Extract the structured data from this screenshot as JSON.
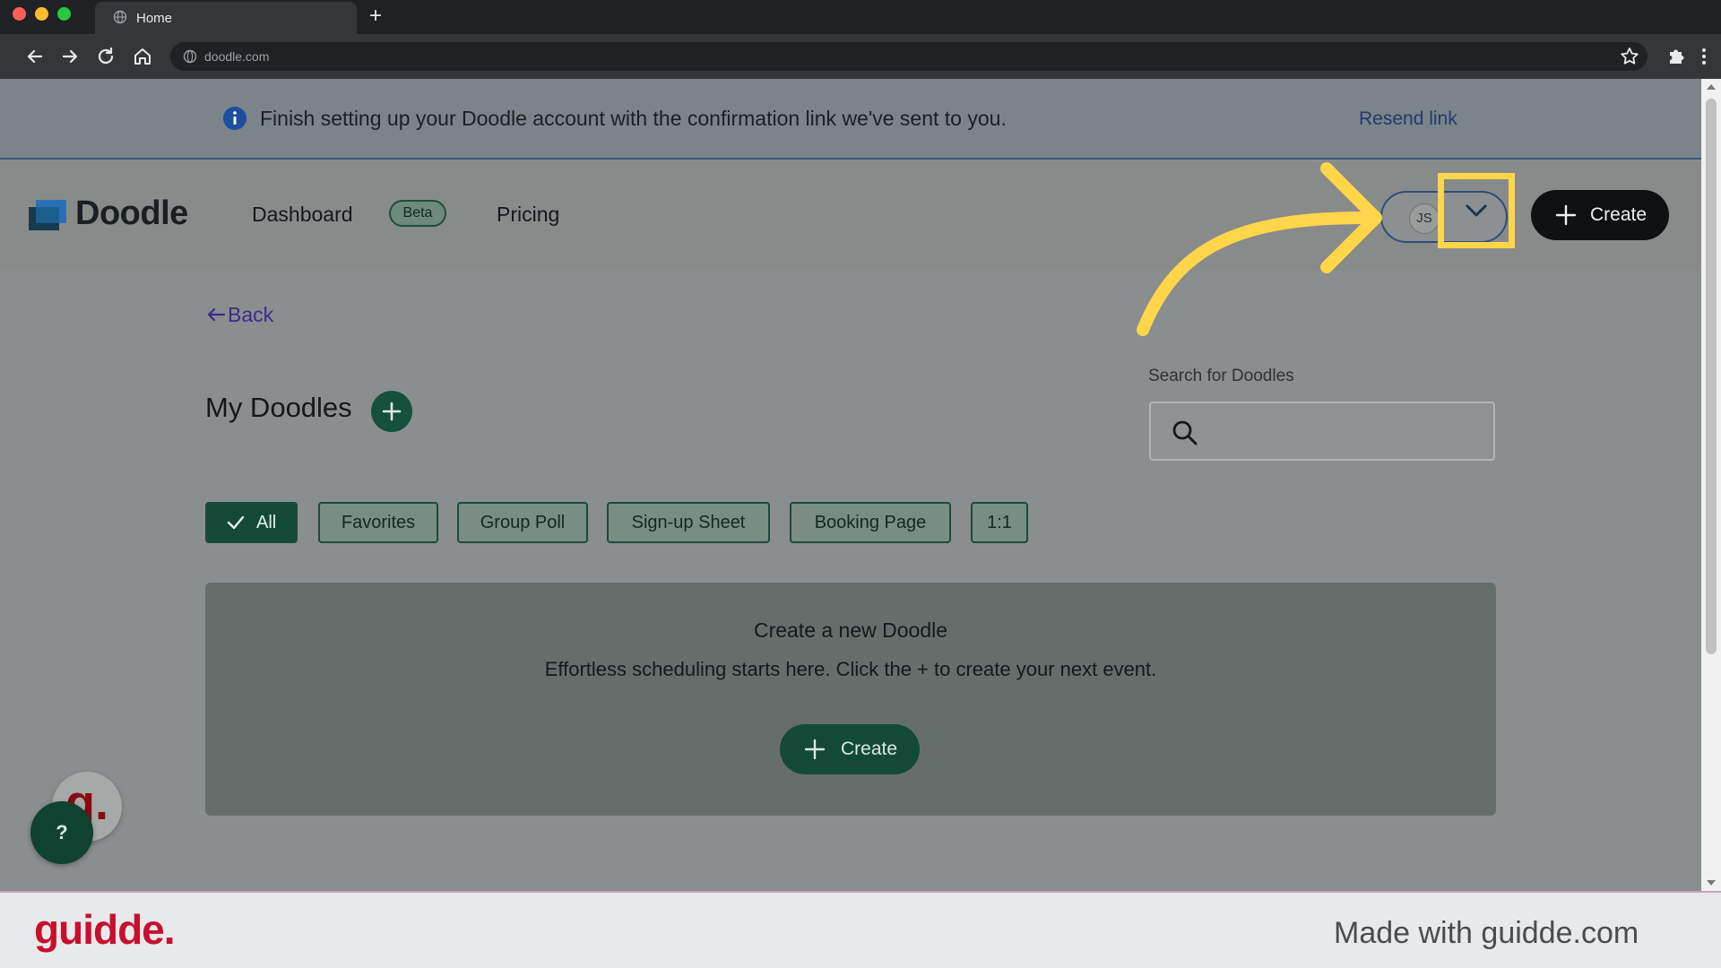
{
  "browser": {
    "tab_title": "Home",
    "new_tab_symbol": "+",
    "url": "doodle.com"
  },
  "banner": {
    "message": "Finish setting up your Doodle account with the confirmation link we've sent to you.",
    "link": "Resend link"
  },
  "header": {
    "logo": "Doodle",
    "nav": {
      "dashboard": "Dashboard",
      "beta": "Beta",
      "pricing": "Pricing"
    },
    "user_initials": "JS",
    "create_label": "Create"
  },
  "main": {
    "back_label": "Back",
    "title": "My Doodles",
    "search_label": "Search for Doodles",
    "search_placeholder": "",
    "filters": [
      {
        "label": "All",
        "active": true
      },
      {
        "label": "Favorites",
        "active": false
      },
      {
        "label": "Group Poll",
        "active": false
      },
      {
        "label": "Sign-up Sheet",
        "active": false
      },
      {
        "label": "Booking Page",
        "active": false
      },
      {
        "label": "1:1",
        "active": false
      }
    ],
    "empty": {
      "title": "Create a new Doodle",
      "subtitle": "Effortless scheduling starts here. Click the + to create your next event.",
      "create_label": "Create"
    }
  },
  "widgets": {
    "guidde_bubble": "g.",
    "help": "?"
  },
  "footer": {
    "logo": "guidde.",
    "text": "Made with guidde.com"
  },
  "colors": {
    "highlight": "#ffd54a",
    "brand_green": "#124a37",
    "guidde_red": "#c8102e"
  }
}
